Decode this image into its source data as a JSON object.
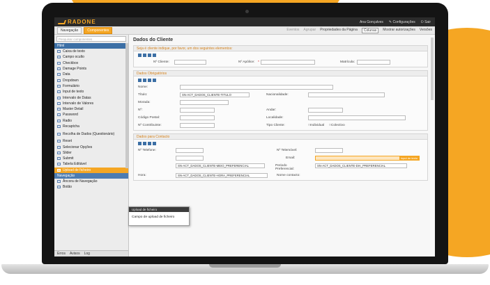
{
  "colors": {
    "accent": "#f5a623",
    "topbar": "#2b2b2b",
    "group_header": "#3c6fa5"
  },
  "app": {
    "logo": "RADONE",
    "user": "Ana Gonçalves",
    "settings": "Configurações",
    "logout": "Sair"
  },
  "toolbar": {
    "tab_navigation": "Navegação",
    "tab_components": "Componentes",
    "item_events": "Eventos",
    "item_groups": "Agrupar",
    "item_properties": "Propriedades da Página",
    "item_columns": "Colunas",
    "item_authorizations": "Mostrar autorizações",
    "item_versions": "Versões"
  },
  "sidebar": {
    "search_placeholder": "Pesquisar componentes",
    "group_html": "Html",
    "components": [
      "Caixa de texto",
      "Campo oculto",
      "Checkbox",
      "Damage Points",
      "Data",
      "Dropdown",
      "Formulário",
      "Input de texto",
      "Intervalo de Datas",
      "Intervalo de Valores",
      "Master Detail",
      "Password",
      "Radio",
      "Recaptcha",
      "Recolha de Dados (Questionário)",
      "Reset",
      "Selecionar Opções",
      "Slider",
      "Submit",
      "Tabela Editável",
      "Upload de ficheiro"
    ],
    "group_nav": "Navegação",
    "nav_items": [
      "Âncora de Navegação",
      "Botão"
    ],
    "bottom_tabs": [
      "Erros",
      "Avisos",
      "Log"
    ]
  },
  "main": {
    "title": "Dados do Cliente",
    "section1": {
      "header": "Seja é cliente indique, por favor, um dos seguintes elementos:",
      "labels": {
        "client_no": "Nº Cliente:",
        "policy_no": "Nº Apólice:",
        "registration": "Matrícula:"
      },
      "policy_required": "*"
    },
    "section2": {
      "header": "Dados Obrigatórios",
      "labels": {
        "name": "Nome:",
        "title": "Título:",
        "nationality": "Nacionalidade:",
        "address": "Morada:",
        "number": "Nº:",
        "floor": "Andar:",
        "postal_code": "Código Postal:",
        "locality": "Localidade:",
        "taxpayer": "Nº Contribuinte:",
        "client_type": "Tipo Cliente:",
        "radio_individual": "Individual",
        "radio_collective": "Colectivo"
      },
      "title_select": "SN-ACT_DADOS_CLIENTE-TITULO"
    },
    "section3": {
      "header": "Dados para Contacto",
      "labels": {
        "phone": "Nº Telefone:",
        "mobile": "Nº Telemóvel:",
        "email": "Email:",
        "period": "Periodo Preferencial:",
        "time": "Hora:",
        "contact_name": "Nome contacto:"
      },
      "email_tag": "Input de texto",
      "period_select_left": "SN-ACT_DADOS_CLIENTE-MEIO_PREFERENCIAL",
      "period_select_right": "SN-ACT_DADOS_CLIENTE-DIA_PREFERENCIAL",
      "time_select": "SN-ACT_DADOS_CLIENTE-HORA_PREFERENCIAL"
    }
  },
  "popup": {
    "title": "Upload de ficheiro",
    "label": "Campo de upload de ficheiro"
  }
}
